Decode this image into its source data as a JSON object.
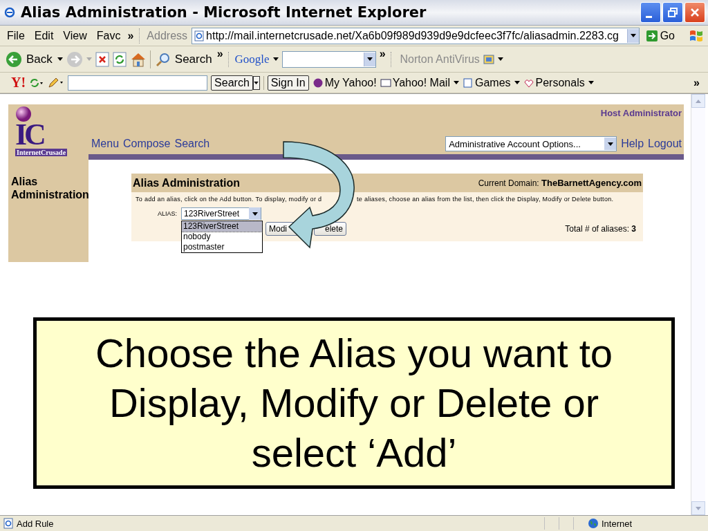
{
  "window": {
    "title": "Alias Administration - Microsoft Internet Explorer"
  },
  "menu_bar": {
    "items": [
      "File",
      "Edit",
      "View",
      "Favc"
    ],
    "overflow": "»",
    "address_label": "Address",
    "address": "http://mail.internetcrusade.net/Xa6b09f989d939d9e9dcfeec3f7fc/aliasadmin.2283.cg",
    "go": "Go"
  },
  "toolbar": {
    "back": "Back",
    "search": "Search",
    "overflow": "»",
    "google": "Google",
    "overflow_2": "»",
    "norton": "Norton AntiVirus"
  },
  "yahoo_toolbar": {
    "logo": "Y!",
    "search": "Search",
    "sign_in": "Sign In",
    "links": [
      "My Yahoo!",
      "Yahoo! Mail",
      "Games",
      "Personals"
    ],
    "overflow": "»"
  },
  "page": {
    "logo": {
      "letters": "IC",
      "name": "InternetCrusade"
    },
    "role": "Host Administrator",
    "nav": [
      "Menu",
      "Compose",
      "Search"
    ],
    "account_options": "Administrative Account Options...",
    "links": [
      "Help",
      "Logout"
    ],
    "sidebar_title": "Alias Administration",
    "panel": {
      "title": "Alias Administration",
      "domain_label": "Current Domain:",
      "domain": "TheBarnettAgency.com",
      "instructions": [
        "To add an alias, click on the Add button. To display, modify or d",
        "te aliases, choose an alias from the list, then click the Display, Modify or Delete button."
      ],
      "alias_label": "ALIAS:",
      "alias_value": "123RiverStreet",
      "options": [
        {
          "label": "123RiverStreet",
          "selected": true
        },
        {
          "label": "nobody",
          "selected": false
        },
        {
          "label": "postmaster",
          "selected": false
        }
      ],
      "buttons": [
        "Modi",
        "elete"
      ],
      "total_label": "Total # of aliases:",
      "total": "3"
    }
  },
  "callout": {
    "text": "Choose the Alias you want to Display, Modify or Delete or select ‘Add’"
  },
  "status_bar": {
    "text": "Add Rule",
    "zone": "Internet"
  }
}
